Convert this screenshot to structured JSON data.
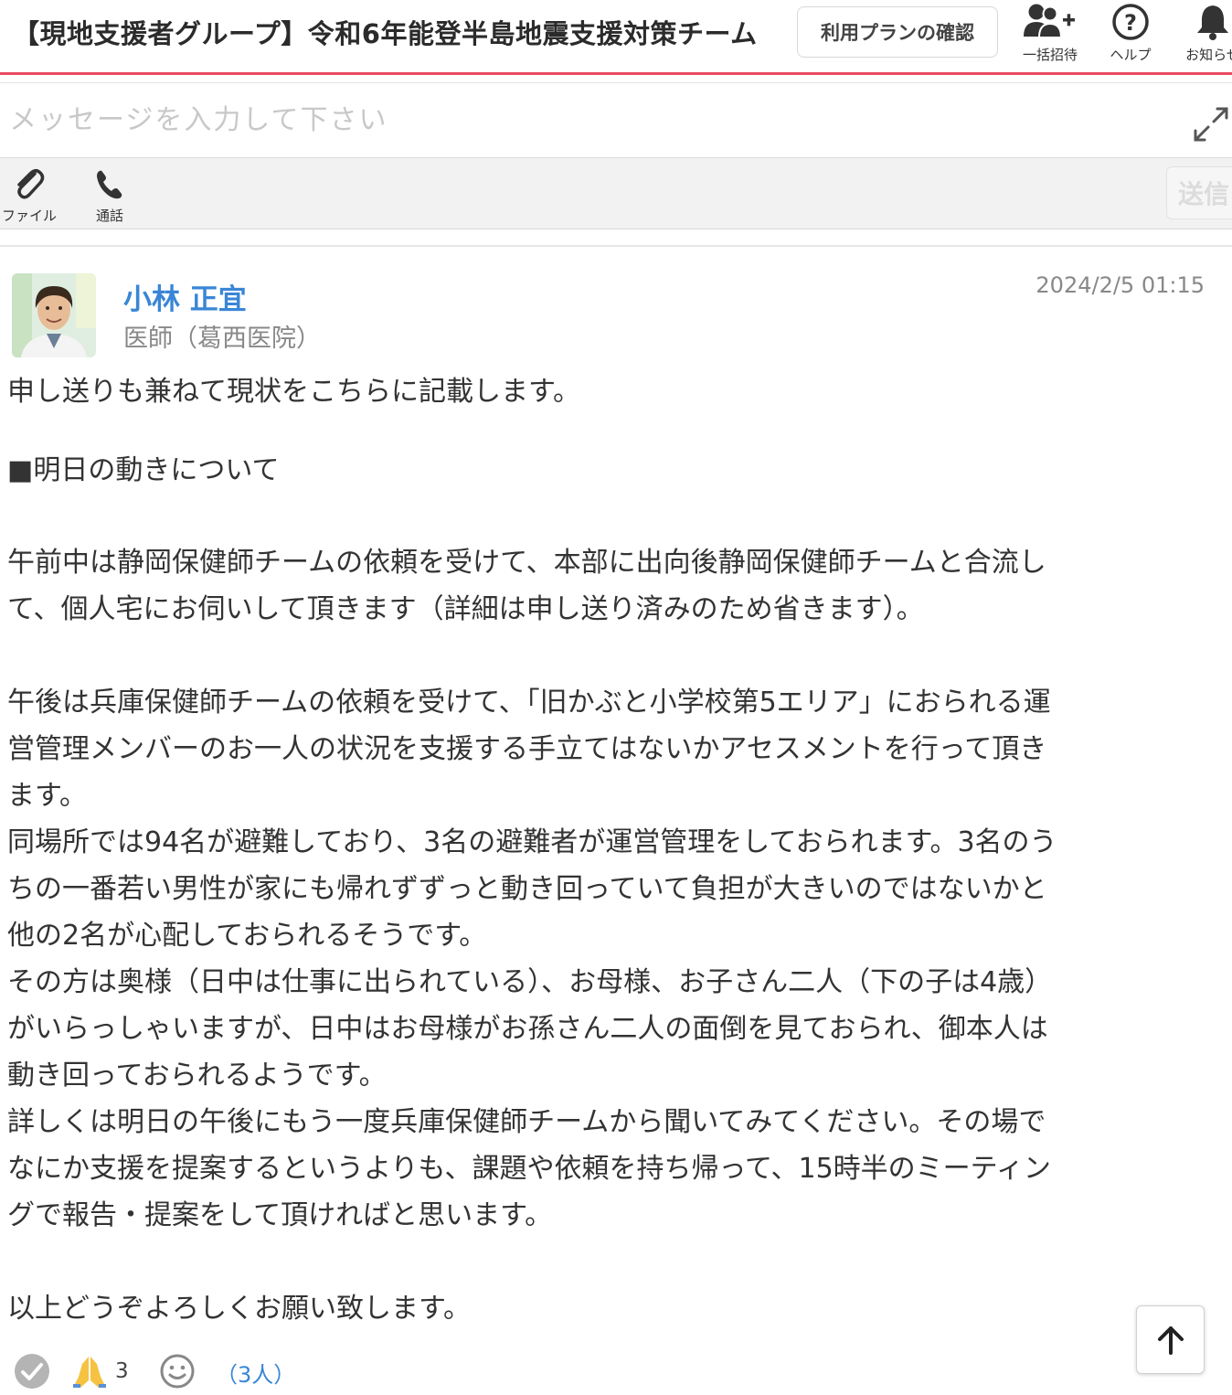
{
  "header": {
    "title": "【現地支援者グループ】令和6年能登半島地震支援対策チーム",
    "plan_button": "利用プランの確認",
    "invite_label": "一括招待",
    "help_label": "ヘルプ",
    "notice_label": "お知らせ"
  },
  "composer": {
    "placeholder": "メッセージを入力して下さい",
    "file_label": "ファイル",
    "call_label": "通話",
    "send_label": "送信"
  },
  "post": {
    "author": "小林 正宜",
    "role": "医師（葛西医院）",
    "timestamp": "2024/2/5 01:15",
    "lines": [
      "申し送りも兼ねて現状をこちらに記載します。",
      "■明日の動きについて",
      "午前中は静岡保健師チームの依頼を受けて、本部に出向後静岡保健師チームと合流し",
      "て、個人宅にお伺いして頂きます（詳細は申し送り済みのため省きます）。",
      "午後は兵庫保健師チームの依頼を受けて、「旧かぶと小学校第5エリア」におられる運",
      "営管理メンバーのお一人の状況を支援する手立てはないかアセスメントを行って頂き",
      "ます。",
      "同場所では94名が避難しており、3名の避難者が運営管理をしておられます。3名のう",
      "ちの一番若い男性が家にも帰れずずっと動き回っていて負担が大きいのではないかと",
      "他の2名が心配しておられるそうです。",
      "その方は奥様（日中は仕事に出られている）、お母様、お子さん二人（下の子は4歳）",
      "がいらっしゃいますが、日中はお母様がお孫さん二人の面倒を見ておられ、御本人は",
      "動き回っておられるようです。",
      "詳しくは明日の午後にもう一度兵庫保健師チームから聞いてみてください。その場で",
      "なにか支援を提案するというよりも、課題や依頼を持ち帰って、15時半のミーティン",
      "グで報告・提案をして頂ければと思います。",
      "以上どうぞよろしくお願い致します。"
    ]
  },
  "reactions": {
    "pray_count": "3",
    "readers": "（3人）"
  },
  "colors": {
    "accent_red": "#e84a5f",
    "link_blue": "#3a86d6"
  },
  "icons": [
    "user-plus-icon",
    "help-icon",
    "bell-icon",
    "expand-icon",
    "paperclip-icon",
    "phone-icon",
    "check-icon",
    "pray-icon",
    "smile-icon",
    "arrow-up-icon"
  ]
}
